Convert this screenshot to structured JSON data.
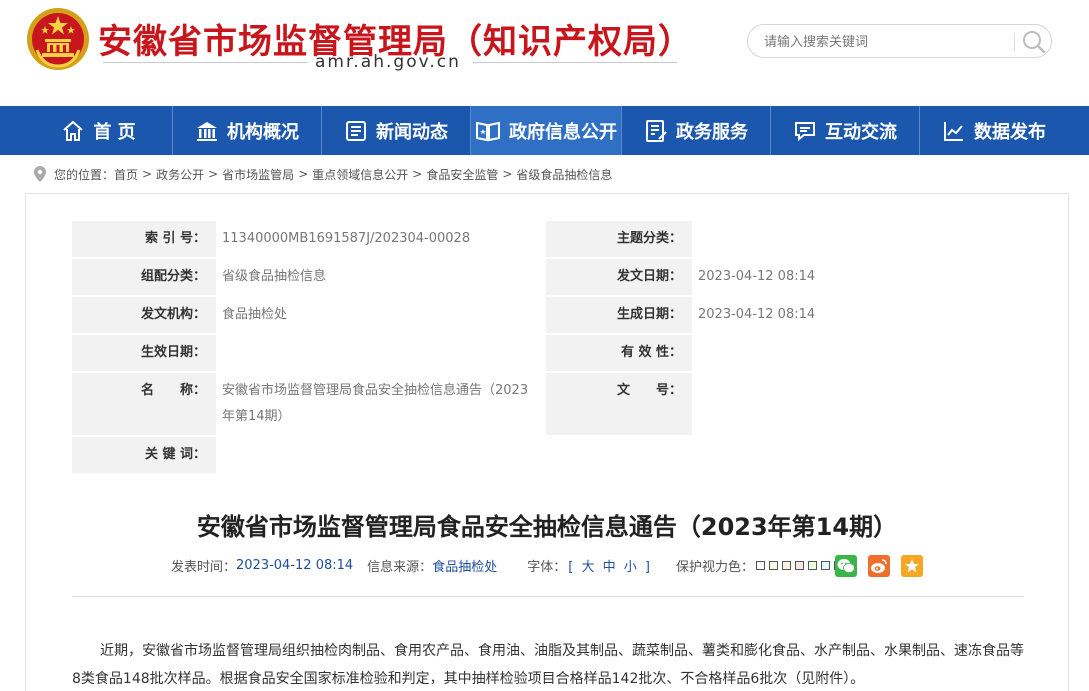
{
  "header": {
    "site_title": "安徽省市场监督管理局（知识产权局）",
    "domain": "amr.ah.gov.cn",
    "search_placeholder": "请输入搜索关键词"
  },
  "nav": {
    "items": [
      {
        "label": "首 页",
        "icon": "home-icon"
      },
      {
        "label": "机构概况",
        "icon": "building-icon"
      },
      {
        "label": "新闻动态",
        "icon": "newspaper-icon"
      },
      {
        "label": "政府信息公开",
        "icon": "open-book-icon",
        "active": true
      },
      {
        "label": "政务服务",
        "icon": "form-icon"
      },
      {
        "label": "互动交流",
        "icon": "chat-icon"
      },
      {
        "label": "数据发布",
        "icon": "line-chart-icon"
      }
    ]
  },
  "breadcrumb": {
    "prefix": "您的位置：",
    "items": [
      "首页",
      "政务公开",
      "省市场监管局",
      "重点领域信息公开",
      "食品安全监管",
      "省级食品抽检信息"
    ],
    "separator": ">"
  },
  "meta": {
    "index_label": "索 引 号：",
    "index_value": "11340000MB1691587J/202304-00028",
    "topic_label": "主题分类：",
    "topic_value": "",
    "category_label": "组配分类：",
    "category_value": "省级食品抽检信息",
    "issue_date_label": "发文日期：",
    "issue_date_value": "2023-04-12 08:14",
    "issuer_label": "发文机构：",
    "issuer_value": "食品抽检处",
    "created_date_label": "生成日期：",
    "created_date_value": "2023-04-12 08:14",
    "effective_date_label": "生效日期：",
    "effective_date_value": "",
    "validity_label": "有 效 性：",
    "validity_value": "",
    "name_label": "名　　称：",
    "name_value": "安徽省市场监督管理局食品安全抽检信息通告（2023年第14期）",
    "doc_no_label": "文　　号：",
    "doc_no_value": "",
    "keywords_label": "关 键 词：",
    "keywords_value": ""
  },
  "article": {
    "title": "安徽省市场监督管理局食品安全抽检信息通告（2023年第14期）",
    "publish_time_label": "发表时间：",
    "publish_time": "2023-04-12 08:14",
    "source_label": "信息来源：",
    "source": "食品抽检处",
    "font_label": "字体：",
    "font_open": "[",
    "font_large": "大",
    "font_medium": "中",
    "font_small": "小",
    "font_close": "]",
    "eye_label": "保护视力色：",
    "swatch_colors": [
      "#ffffff",
      "#fafbe6",
      "#fff2e2",
      "#fde6e0",
      "#f3ffe1",
      "#dafaff",
      "#eaeaef",
      "#ffffff"
    ],
    "share_colors": {
      "wechat": "#39b54a",
      "weibo": "#f06d2b",
      "favorite": "#f5a623"
    },
    "paragraph": "近期，安徽省市场监督管理局组织抽检肉制品、食用农产品、食用油、油脂及其制品、蔬菜制品、薯类和膨化食品、水产制品、水果制品、速冻食品等8类食品148批次样品。根据食品安全国家标准检验和判定，其中抽样检验项目合格样品142批次、不合格样品6批次（见附件）。"
  },
  "colors": {
    "brand_red": "#c8161d",
    "nav_blue": "#1a57ad",
    "nav_active": "#2f6fc4"
  }
}
